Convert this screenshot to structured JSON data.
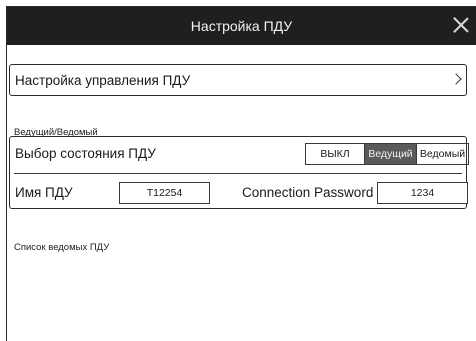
{
  "window": {
    "title": "Настройка ПДУ"
  },
  "control_settings": {
    "label": "Настройка управления ПДУ"
  },
  "master_slave": {
    "section_label": "Ведущий/Ведомый",
    "state_label": "Выбор состояния ПДУ",
    "options": [
      "ВЫКЛ",
      "Ведущий",
      "Ведомый"
    ],
    "selected": "Ведущий",
    "name_label": "Имя ПДУ",
    "name_value": "T12254",
    "password_label": "Connection Password",
    "password_value": "1234"
  },
  "slave_list": {
    "label": "Список ведомых ПДУ"
  },
  "colors": {
    "titlebar": "#1f1f1f",
    "selected_segment": "#5a5a5a"
  }
}
